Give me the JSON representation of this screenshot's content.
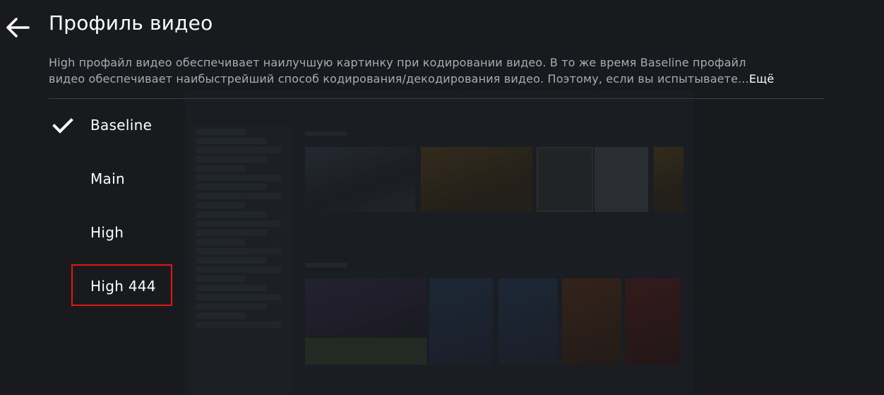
{
  "header": {
    "title": "Профиль видео",
    "back_icon": "arrow-left-icon"
  },
  "description": {
    "line1": "High профайл видео обеспечивает наилучшую картинку при кодировании видео. В то же время Baseline профайл",
    "line2": "видео обеспечивает наибыстрейший способ кодирования/декодирования видео. Поэтому, если вы испытываете...",
    "more_label": "Ещё"
  },
  "profile_options": [
    {
      "label": "Baseline",
      "selected": true
    },
    {
      "label": "Main",
      "selected": false
    },
    {
      "label": "High",
      "selected": false
    },
    {
      "label": "High 444",
      "selected": false,
      "highlighted": true
    }
  ],
  "colors": {
    "background": "#181a1d",
    "text_primary": "#ffffff",
    "text_secondary": "#a8adb3",
    "divider": "#3b4047",
    "highlight_border": "#e01818"
  }
}
